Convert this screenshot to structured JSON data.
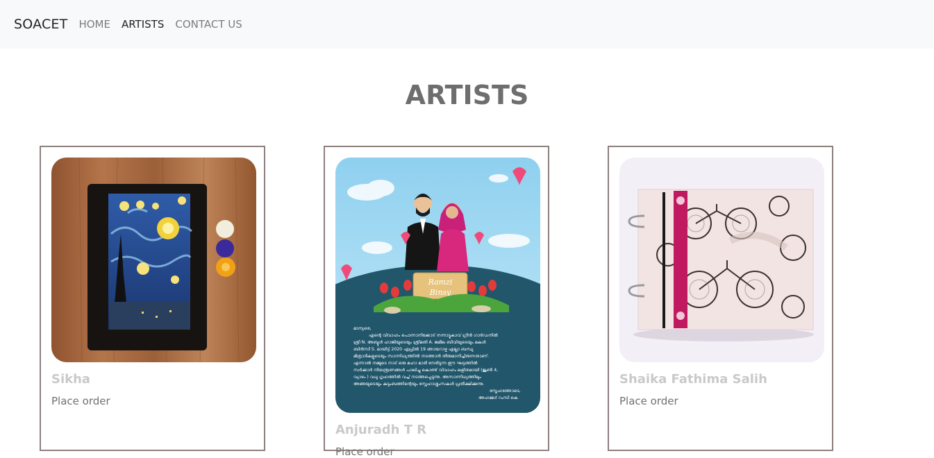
{
  "navbar": {
    "brand": "SOACET",
    "links": [
      {
        "label": "HOME",
        "active": false
      },
      {
        "label": "ARTISTS",
        "active": true
      },
      {
        "label": "CONTACT US",
        "active": false
      }
    ]
  },
  "page_title": "ARTISTS",
  "artists": [
    {
      "name": "Sikha",
      "action": "Place order",
      "image": "starry-night-painted-pouch"
    },
    {
      "name": "Anjuradh T R",
      "action": "Place order",
      "image": "wedding-invitation-caricature"
    },
    {
      "name": "Shaika Fathima Salih",
      "action": "Place order",
      "image": "bicycle-print-scrapbook"
    }
  ],
  "invitation": {
    "names": [
      "Ramzi",
      "Binsy"
    ],
    "body_lines": [
      "മാന്യരെ,",
      "എന്റെ വിവാഹം പൊന്നാനിക്കോട് നന്നാട്ടുകാവ് ഗ്രീൻ ഗാർഡനിൽ",
      "ശ്രീ N. അബ്ദുൾ ഹാജിയുടെയും ശ്രീമതി A. ജമീല ബീവിയുടെയും മകൾ",
      "ബിൻസി S. മായിട്ട് 2020 ഏപ്രിൽ 19 ഞായറാഴ്ച എല്ലാ ബന്ധു",
      "മിത്രാദികളുടെയും സാന്നിധ്യത്തിൽ നടത്താൻ തീരുമാനിച്ചിരുന്നതാണ്.",
      "എന്നാൽ നമ്മുടെ നാട് ഒരു മഹാ മാരി നേരിടുന്ന ഈ ഘട്ടത്തിൽ",
      "സർക്കാർ നിയന്ത്രണങ്ങൾ പാലിച്ചു കൊണ്ട് വിവാഹം ലളിതമായി (ജൂൺ 4,",
      "വ്യാഴം ) വധു ഗൃഹത്തിൽ വച്ച് നടത്തപ്പെടുന്നു. അസാന്നിധ്യത്തിലും",
      "അങ്ങയുടെയും കുടുംബത്തിന്റെയും സ്നേഹാശ്ശംസകൾ പ്രതീക്ഷിക്കുന്നു.",
      "സ്നേഹത്തോടെ,",
      "അഹമ്മദ് റംസി കെ"
    ]
  },
  "colors": {
    "navbar_bg": "#f8f9fa",
    "card_border": "#8e7e7e",
    "title": "#6e6e6e",
    "artist_name": "#c9c9c9"
  }
}
